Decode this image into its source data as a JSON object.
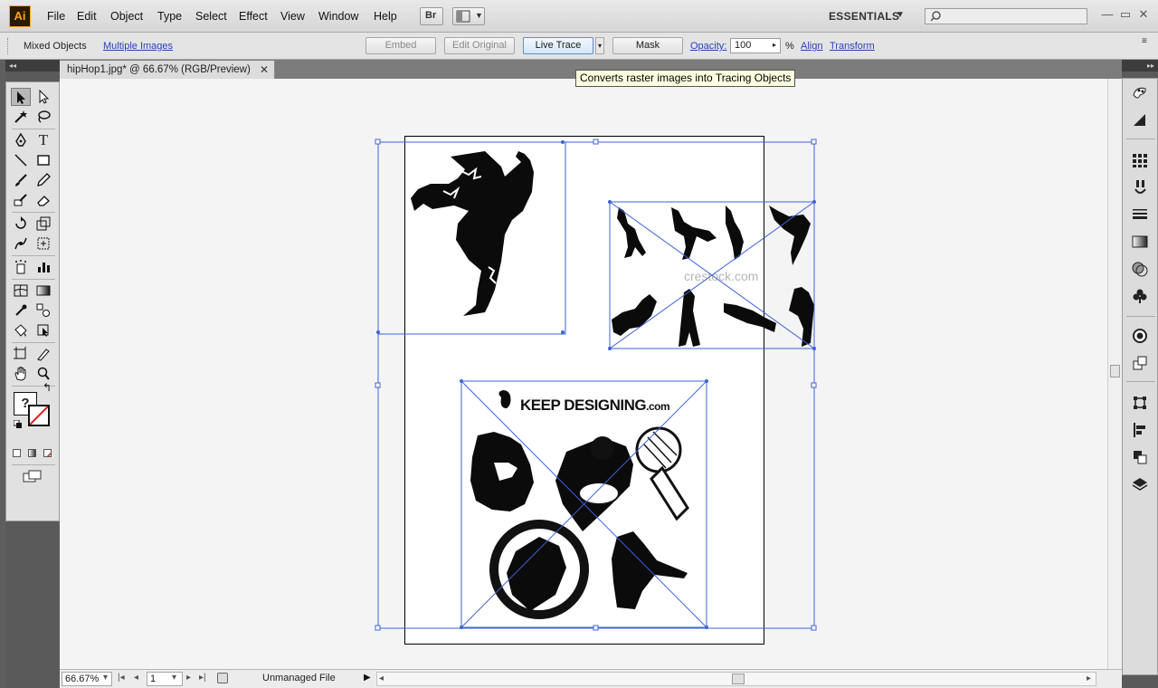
{
  "app": {
    "logo": "Ai"
  },
  "menu": {
    "items": [
      "File",
      "Edit",
      "Object",
      "Type",
      "Select",
      "Effect",
      "View",
      "Window",
      "Help"
    ]
  },
  "menubar_tools": {
    "bridge_label": "Br"
  },
  "workspace": {
    "label": "ESSENTIALS",
    "arrow": "▼"
  },
  "search": {
    "placeholder": ""
  },
  "window_controls": {
    "minimize": "—",
    "restore": "▭",
    "close": "✕"
  },
  "control_bar": {
    "selection_type": "Mixed Objects",
    "multiple_images_link": "Multiple Images",
    "embed_label": "Embed",
    "edit_original_label": "Edit Original",
    "live_trace_label": "Live Trace",
    "live_trace_arrow": "▾",
    "mask_label": "Mask",
    "opacity_label": "Opacity:",
    "opacity_value": "100",
    "opacity_arrow": "▸",
    "opacity_unit": "%",
    "align_link": "Align",
    "transform_link": "Transform",
    "panel_menu": "≡"
  },
  "tooltip": {
    "text": "Converts raster images into Tracing Objects"
  },
  "document_tab": {
    "title": "hipHop1.jpg* @ 66.67% (RGB/Preview)",
    "close": "✕"
  },
  "panels": {
    "left_collapse": "◂◂",
    "right_collapse": "▸▸"
  },
  "tools": {
    "type_tool": "T",
    "question_mark": "?",
    "swap_arrow": "↰"
  },
  "artwork": {
    "keep_designing": "KEEP DESIGNING",
    "keep_designing_suffix": ".com",
    "watermark": "crestock.com"
  },
  "status_bar": {
    "zoom": "66.67%",
    "zoom_arrow": "▾",
    "first_page": "|◂",
    "prev_page": "◂",
    "page": "1",
    "page_arrow": "▾",
    "next_page": "▸",
    "last_page": "▸|",
    "status_text": "Unmanaged File",
    "status_arrow": "▶",
    "scroll_left": "◂",
    "scroll_right": "▸"
  },
  "colors": {
    "selection_blue": "#3e63d6",
    "tooltip_bg": "#ffffe1",
    "ai_orange": "#f7a51c"
  }
}
